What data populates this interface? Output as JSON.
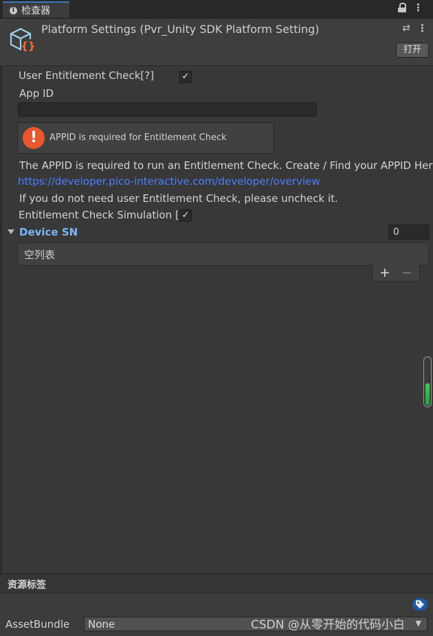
{
  "tab": {
    "label": "检查器"
  },
  "header": {
    "title": "Platform Settings (Pvr_Unity SDK Platform Setting)",
    "open_label": "打开"
  },
  "fields": {
    "user_entitlement_label": "User Entitlement Check[?]",
    "user_entitlement_checked": "✓",
    "app_id_label": "App ID",
    "app_id_value": ""
  },
  "help": {
    "message": "APPID is required for Entitlement Check"
  },
  "info": {
    "line1": "The APPID is required to run an Entitlement Check. Create / Find your APPID Here:",
    "link": "https://developer.pico-interactive.com/developer/overview",
    "line2": "If you do not need user Entitlement Check, please uncheck it.",
    "simulation_label": "Entitlement Check Simulation [?]",
    "simulation_checked": "✓"
  },
  "device_sn": {
    "title": "Device SN",
    "count": "0",
    "empty_label": "空列表",
    "plus": "+",
    "minus": "−"
  },
  "bottom": {
    "labels_title": "资源标签",
    "assetbundle_label": "AssetBundle",
    "assetbundle_value": "None"
  },
  "watermark": "CSDN @从零开始的代码小白",
  "colors": {
    "accent_link": "#4c7eff",
    "section_title": "#7bb6f6",
    "error": "#e8572d"
  }
}
